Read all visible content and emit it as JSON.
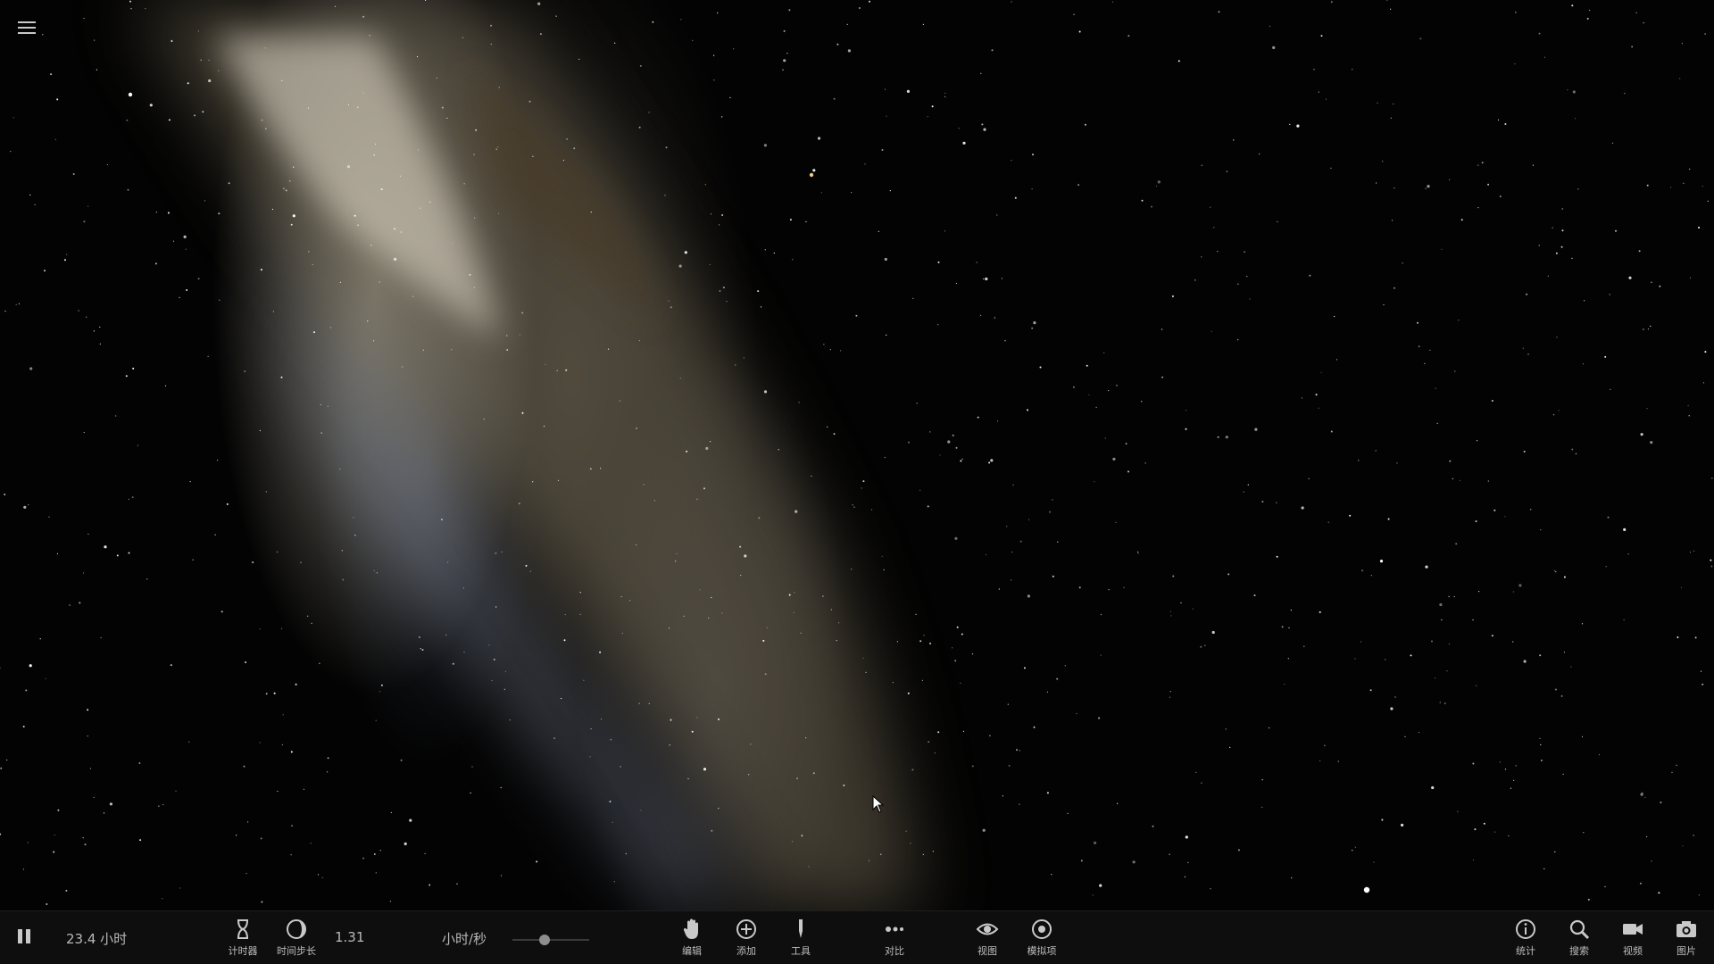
{
  "menu": {
    "icon": "hamburger-menu-icon"
  },
  "time": {
    "pause_icon": "pause-icon",
    "elapsed": "23.4 小时",
    "timer_label": "计时器",
    "timestep_label": "时间步长",
    "rate_value": "1.31",
    "rate_unit": "小时/秒",
    "rate_slider_fraction": 0.42
  },
  "tools": [
    {
      "key": "edit",
      "label": "编辑",
      "icon": "hand-icon"
    },
    {
      "key": "add",
      "label": "添加",
      "icon": "plus-circle-icon"
    },
    {
      "key": "tools",
      "label": "工具",
      "icon": "tool-icon"
    },
    {
      "key": "compare",
      "label": "对比",
      "icon": "dots-icon"
    },
    {
      "key": "view",
      "label": "视图",
      "icon": "eye-icon"
    },
    {
      "key": "sim",
      "label": "模拟项",
      "icon": "target-icon"
    }
  ],
  "right_tools": [
    {
      "key": "stats",
      "label": "统计",
      "icon": "info-icon"
    },
    {
      "key": "search",
      "label": "搜索",
      "icon": "search-icon"
    },
    {
      "key": "video",
      "label": "视频",
      "icon": "video-camera-icon"
    },
    {
      "key": "photo",
      "label": "图片",
      "icon": "camera-icon"
    }
  ],
  "colors": {
    "toolbar_bg": "#0e0e0e",
    "icon": "#c9c9c9",
    "label": "#bcbcbc"
  }
}
